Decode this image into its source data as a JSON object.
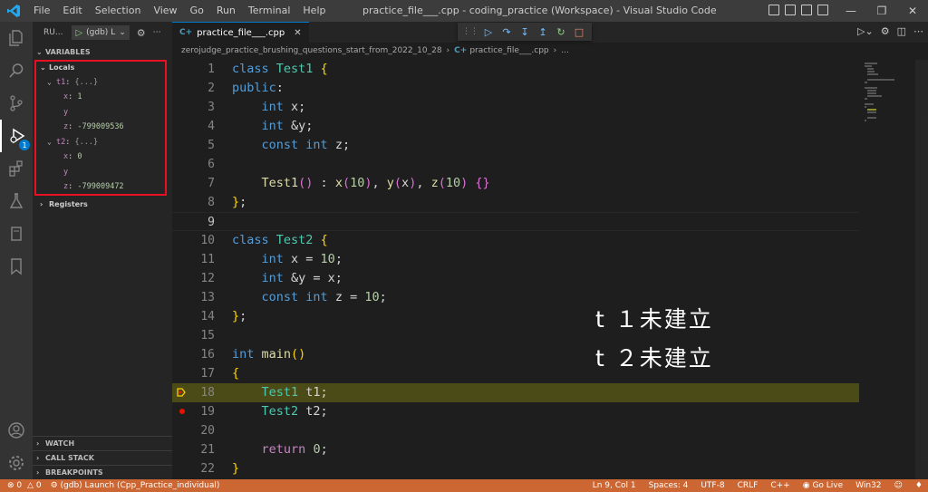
{
  "titlebar": {
    "menu": [
      "File",
      "Edit",
      "Selection",
      "View",
      "Go",
      "Run",
      "Terminal",
      "Help"
    ],
    "title": "practice_file___.cpp - coding_practice (Workspace) - Visual Studio Code"
  },
  "sidebar": {
    "run_label": "RU...",
    "config_label": "(gdb) L",
    "variables_header": "VARIABLES",
    "locals_label": "Locals",
    "locals": [
      {
        "name": "t1",
        "value": "{...}",
        "children": [
          {
            "name": "x",
            "value": "1"
          },
          {
            "name": "y",
            "value": ""
          },
          {
            "name": "z",
            "value": "-799009536"
          }
        ]
      },
      {
        "name": "t2",
        "value": "{...}",
        "children": [
          {
            "name": "x",
            "value": "0"
          },
          {
            "name": "y",
            "value": ""
          },
          {
            "name": "z",
            "value": "-799009472"
          }
        ]
      }
    ],
    "registers_label": "Registers",
    "watch_header": "WATCH",
    "callstack_header": "CALL STACK",
    "breakpoints_header": "BREAKPOINTS"
  },
  "editor": {
    "tab_label": "practice_file___.cpp",
    "breadcrumb": [
      "zerojudge_practice_brushing_questions_start_from_2022_10_28",
      "practice_file___.cpp",
      "..."
    ],
    "line_numbers": [
      "1",
      "2",
      "3",
      "4",
      "5",
      "6",
      "7",
      "8",
      "9",
      "10",
      "11",
      "12",
      "13",
      "14",
      "15",
      "16",
      "17",
      "18",
      "19",
      "20",
      "21",
      "22"
    ],
    "current_line": 9,
    "execution_line": 18,
    "breakpoint_line": 19,
    "overlay_text": [
      "t １未建立",
      "t ２未建立"
    ]
  },
  "statusbar": {
    "errors": "0",
    "warnings": "0",
    "debug_session": "(gdb) Launch (Cpp_Practice_individual)",
    "position": "Ln 9, Col 1",
    "spaces": "Spaces: 4",
    "encoding": "UTF-8",
    "eol": "CRLF",
    "language": "C++",
    "golive": "Go Live",
    "platform": "Win32"
  },
  "colors": {
    "statusbar": "#cc6633",
    "exec_line": "#4b4b18",
    "breakpoint": "#e51400",
    "highlight_box": "#e81123"
  }
}
